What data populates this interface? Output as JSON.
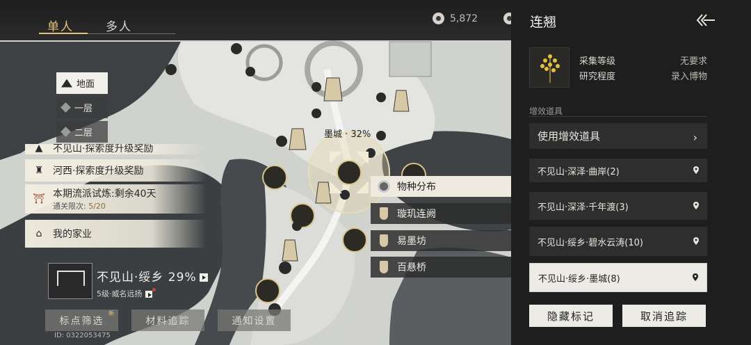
{
  "top": {
    "tab_single": "单人",
    "tab_multi": "多人",
    "currency_amount": "5,872"
  },
  "layers": [
    {
      "label": "地面",
      "active": true
    },
    {
      "label": "一层",
      "active": false
    },
    {
      "label": "二层",
      "active": false
    }
  ],
  "quests": {
    "partial": "不见山·探索度升级奖励",
    "hexi": "河西·探索度升级奖励",
    "trial_title": "本期流派试炼:剩余40天",
    "trial_limit_label": "通关限次:",
    "trial_limit_value": "5/20",
    "home": "我的家业"
  },
  "location": {
    "name": "不见山·绥乡 29%",
    "sub": "5级·威名远扬"
  },
  "bottom_buttons": {
    "filter": "标点筛选",
    "filter_badge": "新",
    "material": "材料追踪",
    "notify": "通知设置"
  },
  "uid": "ID: 0322053475",
  "map": {
    "region_label": "墨城 · 32%",
    "popup": [
      "物种分布",
      "璇玑连阙",
      "易墨坊",
      "百悬桥"
    ]
  },
  "panel": {
    "title": "连翘",
    "gather_label": "采集等级",
    "gather_value": "无要求",
    "research_label": "研究程度",
    "research_value": "录入博物",
    "section_boost": "增效道具",
    "use_boost": "使用增效道具",
    "locations": [
      "不见山·深泽·曲岸(2)",
      "不见山·深泽·千年渡(3)",
      "不见山·绥乡·碧水云涛(10)",
      "不见山·绥乡·墨城(8)"
    ],
    "hide_marks": "隐藏标记",
    "cancel_track": "取消追踪"
  },
  "colors": {
    "accent_gold": "#e7c27a",
    "panel_bg": "#1e1e1e",
    "highlight": "#ecebe5"
  }
}
